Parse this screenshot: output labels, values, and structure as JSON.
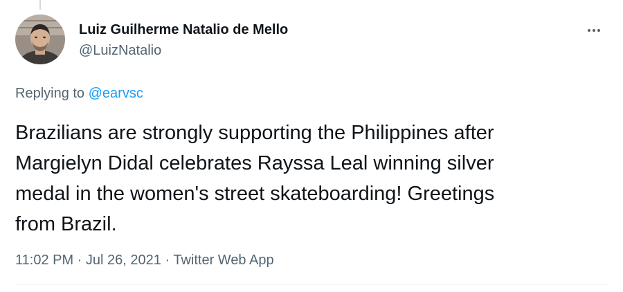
{
  "author": {
    "name": "Luiz Guilherme Natalio de Mello",
    "handle": "@LuizNatalio",
    "avatar": "profile-photo"
  },
  "reply": {
    "prefix": "Replying to",
    "mention": "@earvsc"
  },
  "tweet": {
    "lines": [
      "Brazilians are strongly supporting the Philippines after",
      "Margielyn Didal celebrates Rayssa Leal winning silver",
      "medal in the women's street skateboarding! Greetings",
      "from Brazil."
    ]
  },
  "meta": {
    "time": "11:02 PM",
    "separator": "·",
    "date": "Jul 26, 2021",
    "source": "Twitter Web App"
  },
  "icons": {
    "more": "more-horizontal-icon"
  },
  "colors": {
    "text": "#0f1419",
    "secondary": "#536471",
    "link": "#1d9bf0",
    "divider": "#eff3f4"
  }
}
